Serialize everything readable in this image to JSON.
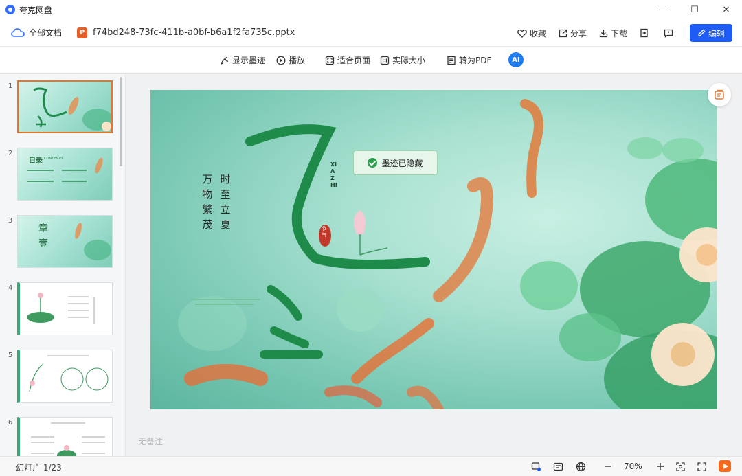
{
  "app": {
    "title": "夸克网盘"
  },
  "window": {
    "minimize": "—",
    "maximize": "☐",
    "close": "✕"
  },
  "header": {
    "all_docs": "全部文档",
    "file_icon_letter": "P",
    "filename": "f74bd248-73fc-411b-a0bf-b6a1f2fa735c.pptx",
    "favorite": "收藏",
    "share": "分享",
    "download": "下载",
    "edit": "编辑"
  },
  "toolbar": {
    "show_ink": "显示墨迹",
    "play": "播放",
    "fit_page": "适合页面",
    "actual_size": "实际大小",
    "to_pdf": "转为PDF",
    "ai_label": "AI"
  },
  "sidebar": {
    "thumbs": [
      {
        "num": "1"
      },
      {
        "num": "2",
        "text": "目录",
        "sub": "CONTENTS"
      },
      {
        "num": "3",
        "text": "章",
        "text2": "壹"
      },
      {
        "num": "4"
      },
      {
        "num": "5"
      },
      {
        "num": "6"
      }
    ]
  },
  "slide": {
    "col1": "万物繁茂",
    "col2": "时至立夏",
    "big1": "夏",
    "big2": "至",
    "pinyin": "XIA ZHI",
    "seal": "节气"
  },
  "toast": {
    "text": "墨迹已隐藏"
  },
  "notes": {
    "placeholder": "无备注"
  },
  "status": {
    "slide_count": "幻灯片 1/23",
    "zoom": "70%"
  },
  "colors": {
    "accent": "#1f5cf5",
    "selected_thumb": "#e8762a",
    "ppt": "#e5602b",
    "play": "#f56a1e"
  }
}
